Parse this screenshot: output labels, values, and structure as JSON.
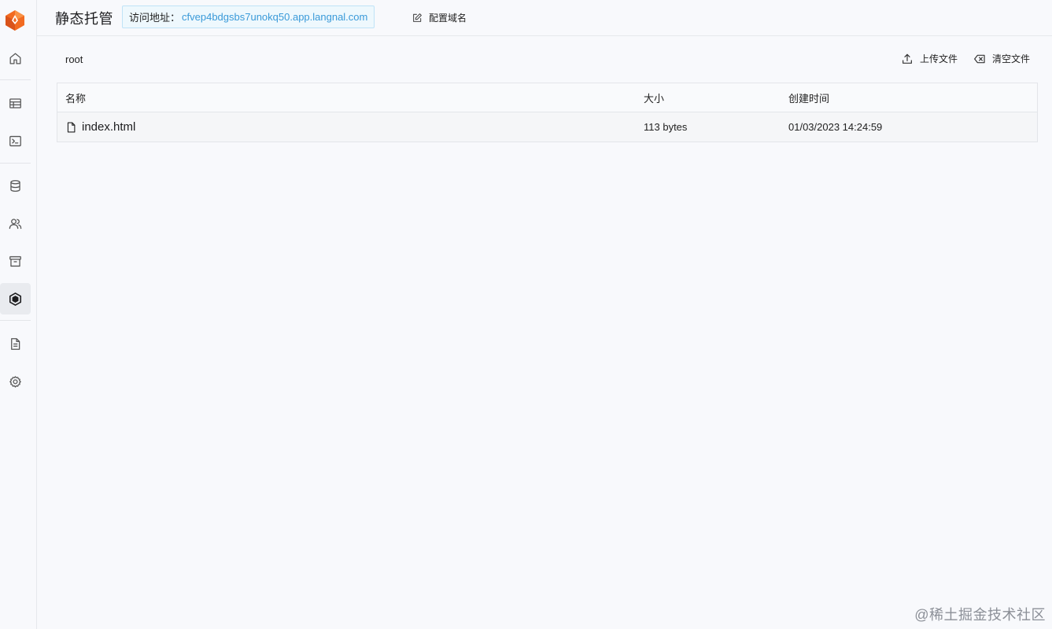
{
  "sidebar": {
    "logo": "laf-logo",
    "items": [
      {
        "name": "home",
        "icon": "home-icon"
      },
      {
        "name": "database-table",
        "icon": "table-icon"
      },
      {
        "name": "terminal",
        "icon": "terminal-icon"
      },
      {
        "name": "database",
        "icon": "database-icon"
      },
      {
        "name": "users",
        "icon": "users-icon"
      },
      {
        "name": "archive",
        "icon": "archive-icon"
      },
      {
        "name": "static-hosting",
        "icon": "hexagon-box-icon",
        "active": true
      },
      {
        "name": "logs",
        "icon": "document-icon"
      },
      {
        "name": "settings",
        "icon": "gear-icon"
      }
    ]
  },
  "header": {
    "title": "静态托管",
    "url_label": "访问地址：",
    "url_value": "cfvep4bdgsbs7unokq50.app.langnal.com",
    "domain_button": "配置域名"
  },
  "main": {
    "breadcrumb": "root",
    "toolbar": {
      "upload_label": "上传文件",
      "clear_label": "清空文件"
    },
    "table": {
      "columns": [
        "名称",
        "大小",
        "创建时间"
      ],
      "rows": [
        {
          "name": "index.html",
          "size": "113 bytes",
          "created": "01/03/2023 14:24:59"
        }
      ]
    }
  },
  "watermark": "@稀土掘金技术社区",
  "colors": {
    "accent": "#3a9ad9",
    "logo_orange": "#f26b21",
    "background": "#f8f9fc"
  }
}
